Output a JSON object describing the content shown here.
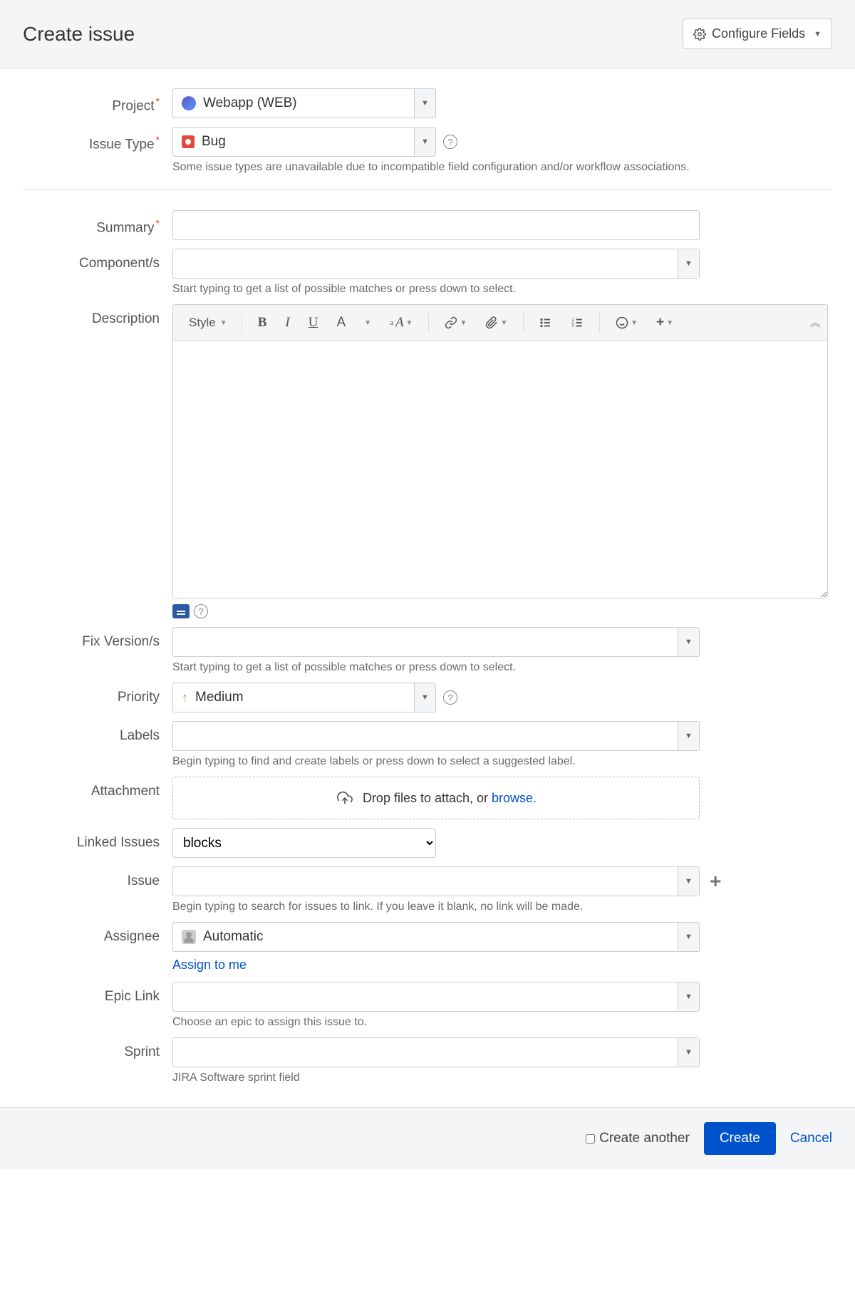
{
  "header": {
    "title": "Create issue",
    "configure": "Configure Fields"
  },
  "fields": {
    "project": {
      "label": "Project",
      "value": "Webapp (WEB)"
    },
    "issueType": {
      "label": "Issue Type",
      "value": "Bug",
      "hint": "Some issue types are unavailable due to incompatible field configuration and/or workflow associations."
    },
    "summary": {
      "label": "Summary"
    },
    "components": {
      "label": "Component/s",
      "hint": "Start typing to get a list of possible matches or press down to select."
    },
    "description": {
      "label": "Description",
      "style": "Style"
    },
    "fixVersions": {
      "label": "Fix Version/s",
      "hint": "Start typing to get a list of possible matches or press down to select."
    },
    "priority": {
      "label": "Priority",
      "value": "Medium"
    },
    "labels": {
      "label": "Labels",
      "hint": "Begin typing to find and create labels or press down to select a suggested label."
    },
    "attachment": {
      "label": "Attachment",
      "dropText": "Drop files to attach, or ",
      "browse": "browse."
    },
    "linkedIssues": {
      "label": "Linked Issues",
      "value": "blocks"
    },
    "issue": {
      "label": "Issue",
      "hint": "Begin typing to search for issues to link. If you leave it blank, no link will be made."
    },
    "assignee": {
      "label": "Assignee",
      "value": "Automatic",
      "assignLink": "Assign to me"
    },
    "epicLink": {
      "label": "Epic Link",
      "hint": "Choose an epic to assign this issue to."
    },
    "sprint": {
      "label": "Sprint",
      "hint": "JIRA Software sprint field"
    }
  },
  "footer": {
    "createAnother": "Create another",
    "create": "Create",
    "cancel": "Cancel"
  }
}
